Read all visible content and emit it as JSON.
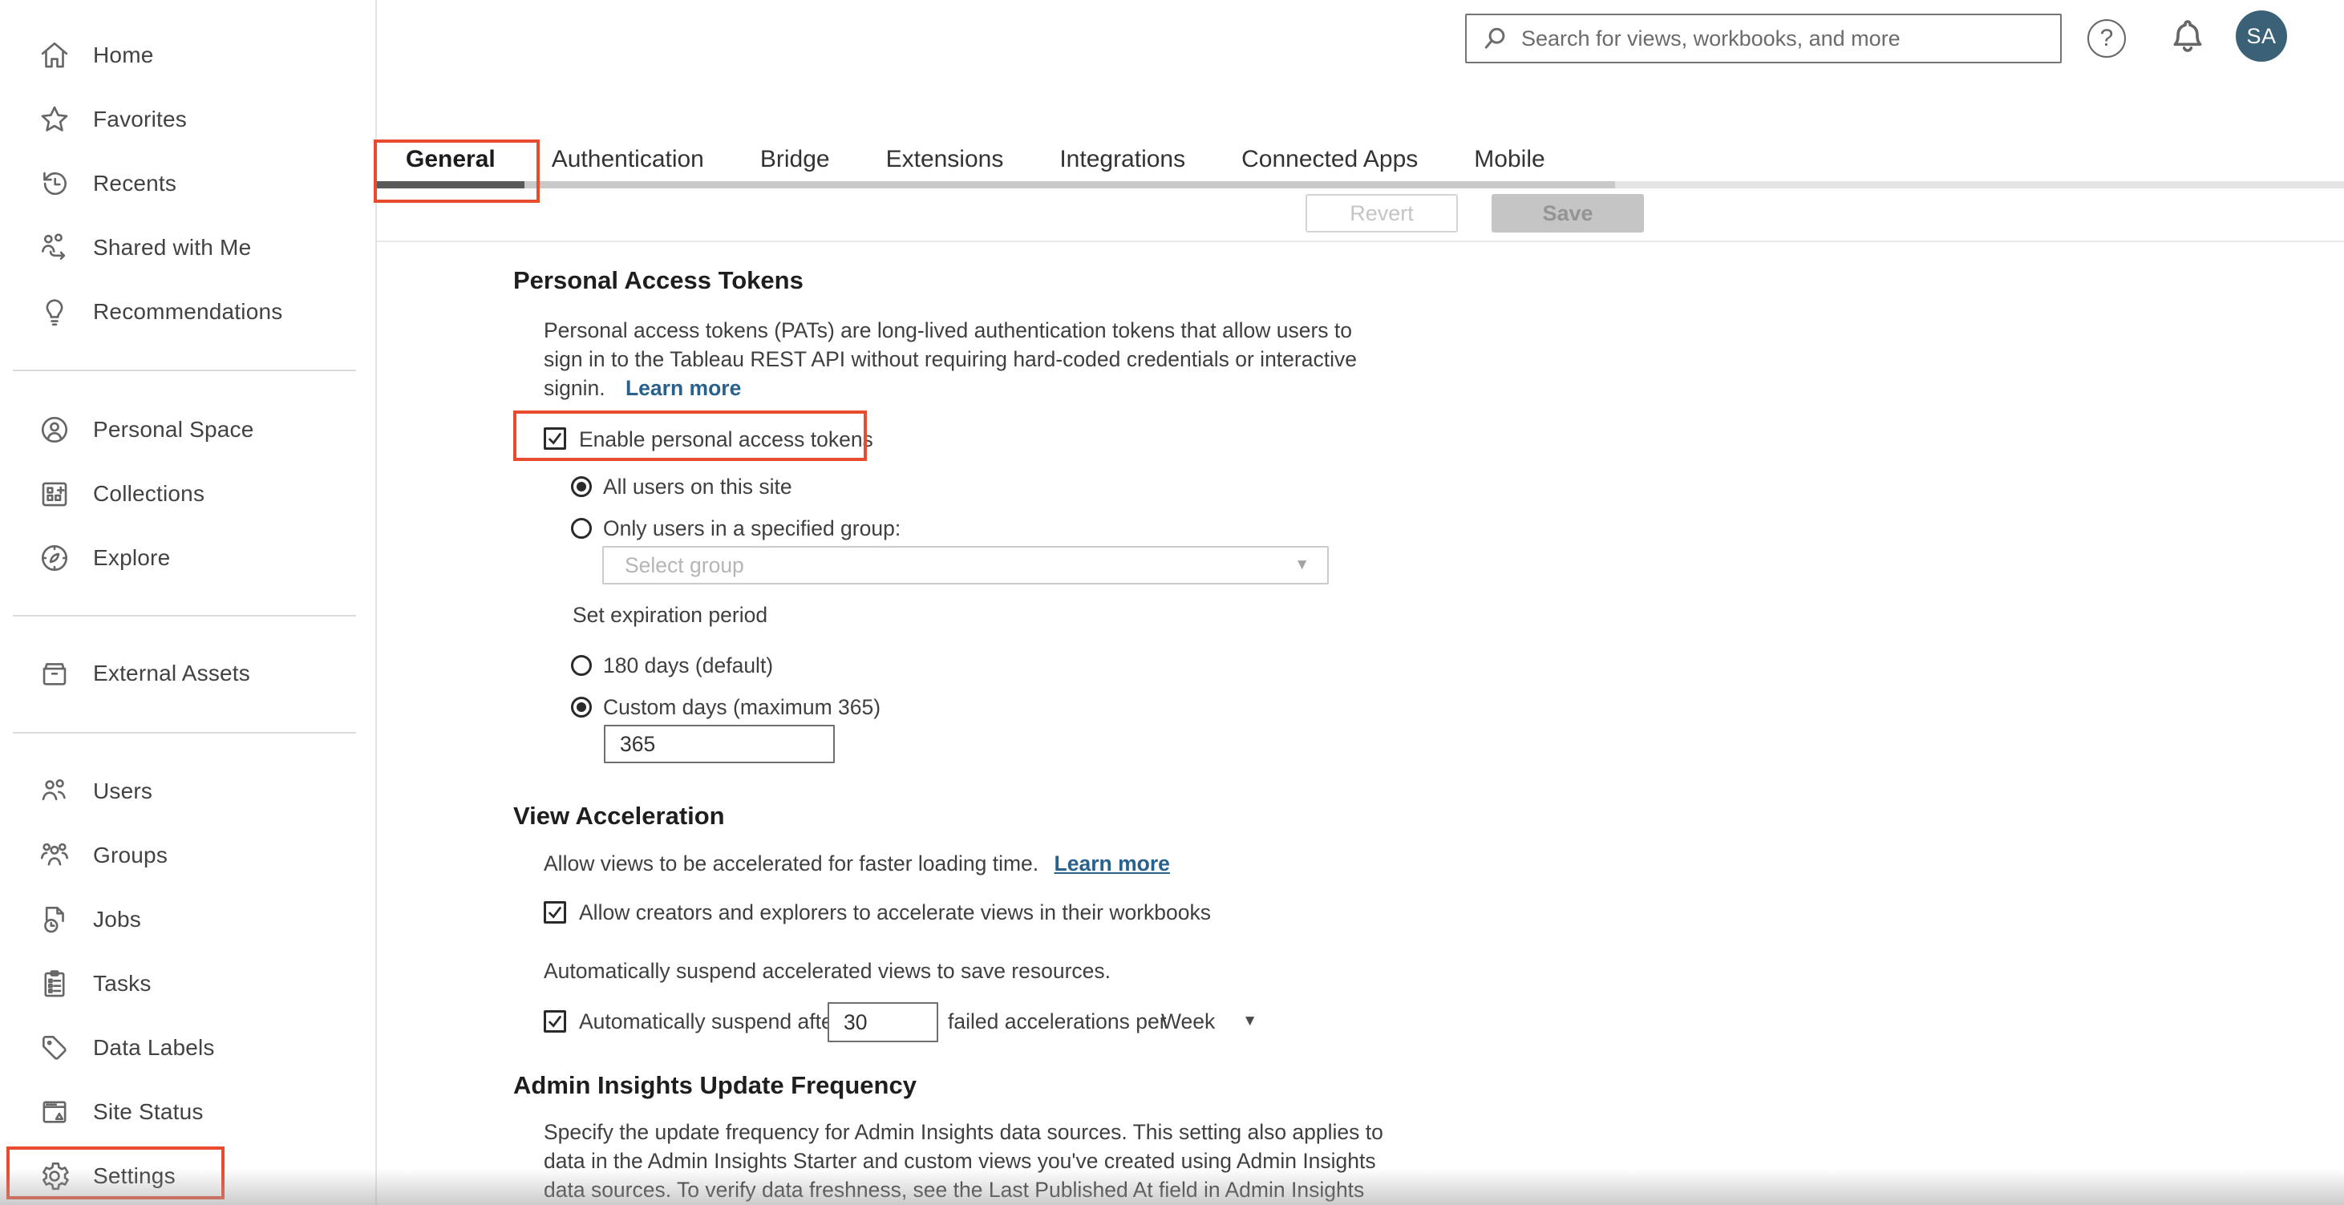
{
  "topbar": {
    "search_placeholder": "Search for views, workbooks, and more",
    "avatar_initials": "SA"
  },
  "sidebar": {
    "items": [
      {
        "label": "Home"
      },
      {
        "label": "Favorites"
      },
      {
        "label": "Recents"
      },
      {
        "label": "Shared with Me"
      },
      {
        "label": "Recommendations"
      },
      {
        "label": "Personal Space"
      },
      {
        "label": "Collections"
      },
      {
        "label": "Explore"
      },
      {
        "label": "External Assets"
      },
      {
        "label": "Users"
      },
      {
        "label": "Groups"
      },
      {
        "label": "Jobs"
      },
      {
        "label": "Tasks"
      },
      {
        "label": "Data Labels"
      },
      {
        "label": "Site Status"
      },
      {
        "label": "Settings"
      }
    ],
    "active_item": "Settings"
  },
  "tabs": {
    "items": [
      {
        "label": "General"
      },
      {
        "label": "Authentication"
      },
      {
        "label": "Bridge"
      },
      {
        "label": "Extensions"
      },
      {
        "label": "Integrations"
      },
      {
        "label": "Connected Apps"
      },
      {
        "label": "Mobile"
      }
    ],
    "active": "General"
  },
  "toolbar": {
    "revert_label": "Revert",
    "save_label": "Save",
    "revert_enabled": false,
    "save_enabled": false
  },
  "sections": {
    "pat": {
      "title": "Personal Access Tokens",
      "description_lines": [
        "Personal access tokens (PATs) are long-lived authentication tokens that allow users to",
        "sign in to the Tableau REST API without requiring hard-coded credentials or interactive",
        "signin."
      ],
      "learn_more_label": "Learn more",
      "enable_label": "Enable personal access tokens",
      "enable_checked": true,
      "radio_all_users_label": "All users on this site",
      "radio_all_users_selected": true,
      "radio_specified_group_label": "Only users in a specified group:",
      "radio_specified_group_selected": false,
      "select_group_placeholder": "Select group",
      "expiration_label": "Set expiration period",
      "radio_180_label": "180 days (default)",
      "radio_180_selected": false,
      "radio_custom_label": "Custom days (maximum 365)",
      "radio_custom_selected": true,
      "custom_days_value": "365"
    },
    "view_acceleration": {
      "title": "View Acceleration",
      "description": "Allow views to be accelerated for faster loading time.",
      "learn_more_label": "Learn more",
      "allow_checkbox_label": "Allow creators and explorers to accelerate views in their workbooks",
      "allow_checked": true,
      "suspend_text": "Automatically suspend accelerated views to save resources.",
      "suspend_after_label": "Automatically suspend after",
      "suspend_checked": true,
      "suspend_count_value": "30",
      "failed_per_label": "failed accelerations per",
      "period_value": "Week"
    },
    "admin_insights": {
      "title": "Admin Insights Update Frequency",
      "description_lines": [
        "Specify the update frequency for Admin Insights data sources. This setting also applies to",
        "data in the Admin Insights Starter and custom views you've created using Admin Insights",
        "data sources. To verify data freshness, see the Last Published At field in Admin Insights"
      ]
    }
  },
  "colors": {
    "accent_red": "#e94b2f",
    "link_blue": "#28618c",
    "avatar_bg": "#3b6177",
    "active_tab_underline": "#595959"
  }
}
